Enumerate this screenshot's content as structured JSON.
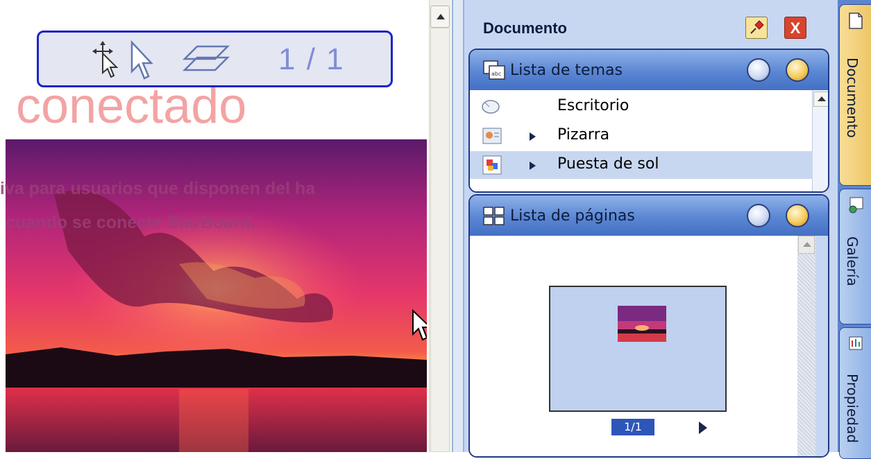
{
  "canvas": {
    "toolbar": {
      "page_indicator": "1 / 1"
    },
    "title_fragment": "n conectado",
    "overlay_line1": "siva para usuarios que disponen del ha",
    "overlay_line2": "n cuando se conecte StarBoard."
  },
  "panel": {
    "title": "Documento",
    "close_label": "X",
    "themes": {
      "title": "Lista de temas",
      "items": [
        {
          "label": "Escritorio",
          "selected": false
        },
        {
          "label": "Pizarra",
          "selected": false
        },
        {
          "label": "Puesta de sol",
          "selected": true
        }
      ]
    },
    "pages": {
      "title": "Lista de páginas",
      "current": "1/1"
    }
  },
  "tabs": [
    {
      "label": "Documento",
      "active": true
    },
    {
      "label": "Galería",
      "active": false
    },
    {
      "label": "Propiedad",
      "active": false
    }
  ],
  "colors": {
    "toolbar_border": "#1b24c8",
    "title_pink": "#f3a3a3",
    "panel_blue": "#5a86d3",
    "tab_active": "#f8dd96"
  }
}
